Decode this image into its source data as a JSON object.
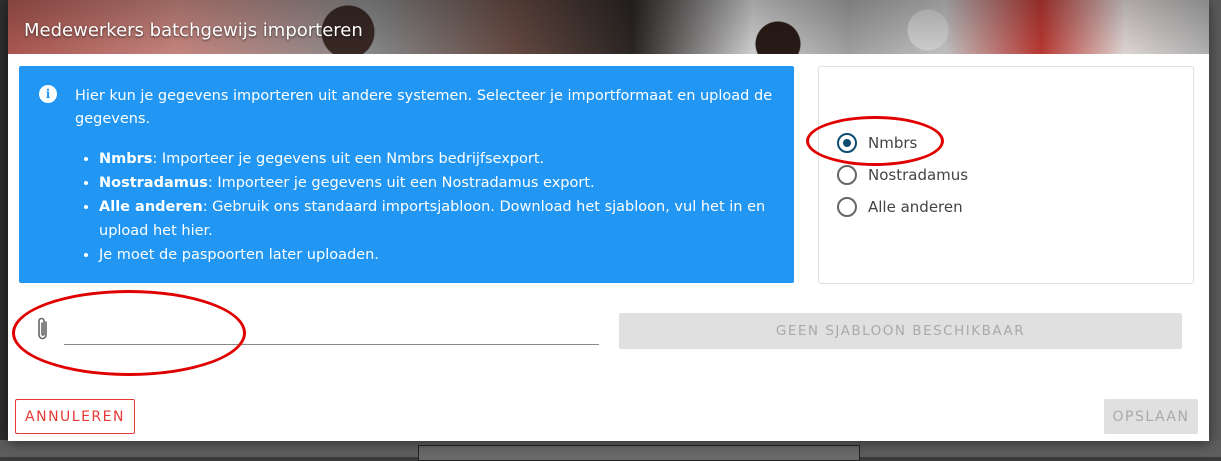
{
  "dialog": {
    "title": "Medewerkers batchgewijs importeren"
  },
  "info": {
    "intro": "Hier kun je gegevens importeren uit andere systemen. Selecteer je importformaat en upload de gegevens.",
    "items": [
      {
        "name": "Nmbrs",
        "text": ": Importeer je gegevens uit een Nmbrs bedrijfsexport."
      },
      {
        "name": "Nostradamus",
        "text": ": Importeer je gegevens uit een Nostradamus export."
      },
      {
        "name": "Alle anderen",
        "text": ": Gebruik ons standaard importsjabloon. Download het sjabloon, vul het in en upload het hier."
      },
      {
        "name": "",
        "text": "Je moet de paspoorten later uploaden."
      }
    ]
  },
  "format_options": [
    {
      "label": "Nmbrs",
      "checked": true
    },
    {
      "label": "Nostradamus",
      "checked": false
    },
    {
      "label": "Alle anderen",
      "checked": false
    }
  ],
  "file_upload": {
    "value": "",
    "icon": "paperclip-icon"
  },
  "buttons": {
    "template": "GEEN SJABLOON BESCHIKBAAR",
    "cancel": "ANNULEREN",
    "save": "OPSLAAN"
  },
  "colors": {
    "info_bg": "#2196f3",
    "radio_selected": "#0d4d6f",
    "cancel": "#e53935",
    "highlight": "#e00000"
  }
}
